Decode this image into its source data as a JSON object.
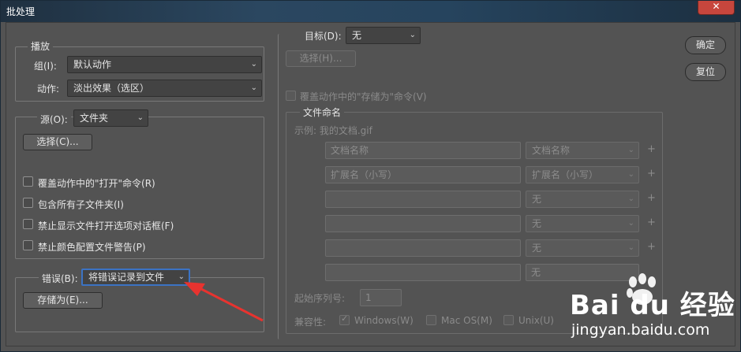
{
  "window": {
    "title": "批处理",
    "close_icon": "close-icon"
  },
  "buttons": {
    "ok": "确定",
    "reset": "复位"
  },
  "play": {
    "legend": "播放",
    "set_label": "组(I):",
    "set_value": "默认动作",
    "action_label": "动作:",
    "action_value": "淡出效果（选区）"
  },
  "source": {
    "label": "源(O):",
    "value": "文件夹",
    "choose": "选择(C)...",
    "options": [
      "覆盖动作中的\"打开\"命令(R)",
      "包含所有子文件夹(I)",
      "禁止显示文件打开选项对话框(F)",
      "禁止颜色配置文件警告(P)"
    ]
  },
  "errors": {
    "label": "错误(B):",
    "value": "将错误记录到文件",
    "save_as": "存储为(E)..."
  },
  "destination": {
    "label": "目标(D):",
    "value": "无",
    "choose": "选择(H)...",
    "override_save": "覆盖动作中的\"存储为\"命令(V)"
  },
  "naming": {
    "legend": "文件命名",
    "example": "示例: 我的文档.gif",
    "rows": [
      {
        "field": "文档名称",
        "select": "文档名称"
      },
      {
        "field": "扩展名（小写）",
        "select": "扩展名（小写）"
      },
      {
        "field": "",
        "select": "无"
      },
      {
        "field": "",
        "select": "无"
      },
      {
        "field": "",
        "select": "无"
      },
      {
        "field": "",
        "select": "无"
      }
    ],
    "serial_label": "起始序列号:",
    "serial_value": "1",
    "compat_label": "兼容性:",
    "compat": [
      {
        "label": "Windows(W)",
        "checked": true
      },
      {
        "label": "Mac OS(M)",
        "checked": false
      },
      {
        "label": "Unix(U)",
        "checked": false
      }
    ]
  },
  "watermark": {
    "brand": "Bai du 经验",
    "url": "jingyan.baidu.com"
  },
  "colors": {
    "panel": "#535353",
    "focus": "#3b73c4",
    "arrow": "#e8332f"
  }
}
